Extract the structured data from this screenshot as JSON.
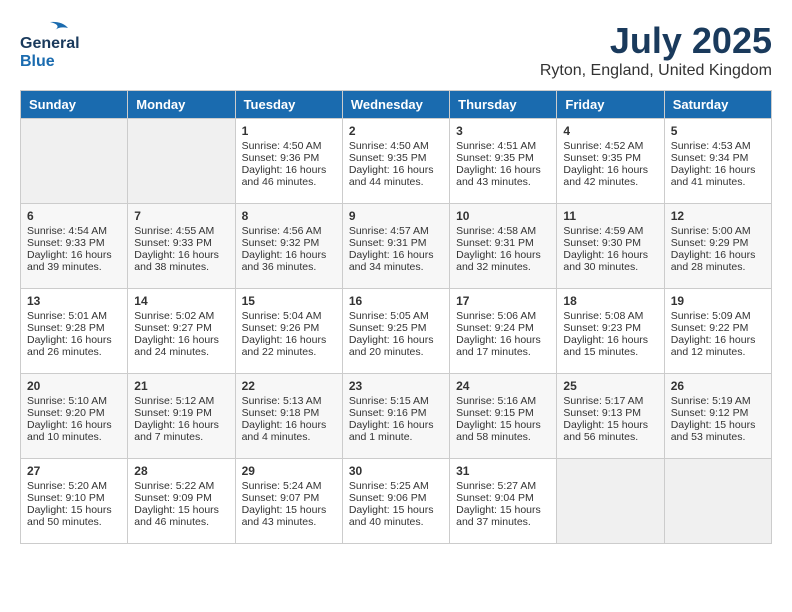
{
  "header": {
    "logo_line1": "General",
    "logo_line2": "Blue",
    "month_title": "July 2025",
    "location": "Ryton, England, United Kingdom"
  },
  "days_of_week": [
    "Sunday",
    "Monday",
    "Tuesday",
    "Wednesday",
    "Thursday",
    "Friday",
    "Saturday"
  ],
  "weeks": [
    [
      {
        "day": "",
        "sunrise": "",
        "sunset": "",
        "daylight": ""
      },
      {
        "day": "",
        "sunrise": "",
        "sunset": "",
        "daylight": ""
      },
      {
        "day": "1",
        "sunrise": "Sunrise: 4:50 AM",
        "sunset": "Sunset: 9:36 PM",
        "daylight": "Daylight: 16 hours and 46 minutes."
      },
      {
        "day": "2",
        "sunrise": "Sunrise: 4:50 AM",
        "sunset": "Sunset: 9:35 PM",
        "daylight": "Daylight: 16 hours and 44 minutes."
      },
      {
        "day": "3",
        "sunrise": "Sunrise: 4:51 AM",
        "sunset": "Sunset: 9:35 PM",
        "daylight": "Daylight: 16 hours and 43 minutes."
      },
      {
        "day": "4",
        "sunrise": "Sunrise: 4:52 AM",
        "sunset": "Sunset: 9:35 PM",
        "daylight": "Daylight: 16 hours and 42 minutes."
      },
      {
        "day": "5",
        "sunrise": "Sunrise: 4:53 AM",
        "sunset": "Sunset: 9:34 PM",
        "daylight": "Daylight: 16 hours and 41 minutes."
      }
    ],
    [
      {
        "day": "6",
        "sunrise": "Sunrise: 4:54 AM",
        "sunset": "Sunset: 9:33 PM",
        "daylight": "Daylight: 16 hours and 39 minutes."
      },
      {
        "day": "7",
        "sunrise": "Sunrise: 4:55 AM",
        "sunset": "Sunset: 9:33 PM",
        "daylight": "Daylight: 16 hours and 38 minutes."
      },
      {
        "day": "8",
        "sunrise": "Sunrise: 4:56 AM",
        "sunset": "Sunset: 9:32 PM",
        "daylight": "Daylight: 16 hours and 36 minutes."
      },
      {
        "day": "9",
        "sunrise": "Sunrise: 4:57 AM",
        "sunset": "Sunset: 9:31 PM",
        "daylight": "Daylight: 16 hours and 34 minutes."
      },
      {
        "day": "10",
        "sunrise": "Sunrise: 4:58 AM",
        "sunset": "Sunset: 9:31 PM",
        "daylight": "Daylight: 16 hours and 32 minutes."
      },
      {
        "day": "11",
        "sunrise": "Sunrise: 4:59 AM",
        "sunset": "Sunset: 9:30 PM",
        "daylight": "Daylight: 16 hours and 30 minutes."
      },
      {
        "day": "12",
        "sunrise": "Sunrise: 5:00 AM",
        "sunset": "Sunset: 9:29 PM",
        "daylight": "Daylight: 16 hours and 28 minutes."
      }
    ],
    [
      {
        "day": "13",
        "sunrise": "Sunrise: 5:01 AM",
        "sunset": "Sunset: 9:28 PM",
        "daylight": "Daylight: 16 hours and 26 minutes."
      },
      {
        "day": "14",
        "sunrise": "Sunrise: 5:02 AM",
        "sunset": "Sunset: 9:27 PM",
        "daylight": "Daylight: 16 hours and 24 minutes."
      },
      {
        "day": "15",
        "sunrise": "Sunrise: 5:04 AM",
        "sunset": "Sunset: 9:26 PM",
        "daylight": "Daylight: 16 hours and 22 minutes."
      },
      {
        "day": "16",
        "sunrise": "Sunrise: 5:05 AM",
        "sunset": "Sunset: 9:25 PM",
        "daylight": "Daylight: 16 hours and 20 minutes."
      },
      {
        "day": "17",
        "sunrise": "Sunrise: 5:06 AM",
        "sunset": "Sunset: 9:24 PM",
        "daylight": "Daylight: 16 hours and 17 minutes."
      },
      {
        "day": "18",
        "sunrise": "Sunrise: 5:08 AM",
        "sunset": "Sunset: 9:23 PM",
        "daylight": "Daylight: 16 hours and 15 minutes."
      },
      {
        "day": "19",
        "sunrise": "Sunrise: 5:09 AM",
        "sunset": "Sunset: 9:22 PM",
        "daylight": "Daylight: 16 hours and 12 minutes."
      }
    ],
    [
      {
        "day": "20",
        "sunrise": "Sunrise: 5:10 AM",
        "sunset": "Sunset: 9:20 PM",
        "daylight": "Daylight: 16 hours and 10 minutes."
      },
      {
        "day": "21",
        "sunrise": "Sunrise: 5:12 AM",
        "sunset": "Sunset: 9:19 PM",
        "daylight": "Daylight: 16 hours and 7 minutes."
      },
      {
        "day": "22",
        "sunrise": "Sunrise: 5:13 AM",
        "sunset": "Sunset: 9:18 PM",
        "daylight": "Daylight: 16 hours and 4 minutes."
      },
      {
        "day": "23",
        "sunrise": "Sunrise: 5:15 AM",
        "sunset": "Sunset: 9:16 PM",
        "daylight": "Daylight: 16 hours and 1 minute."
      },
      {
        "day": "24",
        "sunrise": "Sunrise: 5:16 AM",
        "sunset": "Sunset: 9:15 PM",
        "daylight": "Daylight: 15 hours and 58 minutes."
      },
      {
        "day": "25",
        "sunrise": "Sunrise: 5:17 AM",
        "sunset": "Sunset: 9:13 PM",
        "daylight": "Daylight: 15 hours and 56 minutes."
      },
      {
        "day": "26",
        "sunrise": "Sunrise: 5:19 AM",
        "sunset": "Sunset: 9:12 PM",
        "daylight": "Daylight: 15 hours and 53 minutes."
      }
    ],
    [
      {
        "day": "27",
        "sunrise": "Sunrise: 5:20 AM",
        "sunset": "Sunset: 9:10 PM",
        "daylight": "Daylight: 15 hours and 50 minutes."
      },
      {
        "day": "28",
        "sunrise": "Sunrise: 5:22 AM",
        "sunset": "Sunset: 9:09 PM",
        "daylight": "Daylight: 15 hours and 46 minutes."
      },
      {
        "day": "29",
        "sunrise": "Sunrise: 5:24 AM",
        "sunset": "Sunset: 9:07 PM",
        "daylight": "Daylight: 15 hours and 43 minutes."
      },
      {
        "day": "30",
        "sunrise": "Sunrise: 5:25 AM",
        "sunset": "Sunset: 9:06 PM",
        "daylight": "Daylight: 15 hours and 40 minutes."
      },
      {
        "day": "31",
        "sunrise": "Sunrise: 5:27 AM",
        "sunset": "Sunset: 9:04 PM",
        "daylight": "Daylight: 15 hours and 37 minutes."
      },
      {
        "day": "",
        "sunrise": "",
        "sunset": "",
        "daylight": ""
      },
      {
        "day": "",
        "sunrise": "",
        "sunset": "",
        "daylight": ""
      }
    ]
  ]
}
